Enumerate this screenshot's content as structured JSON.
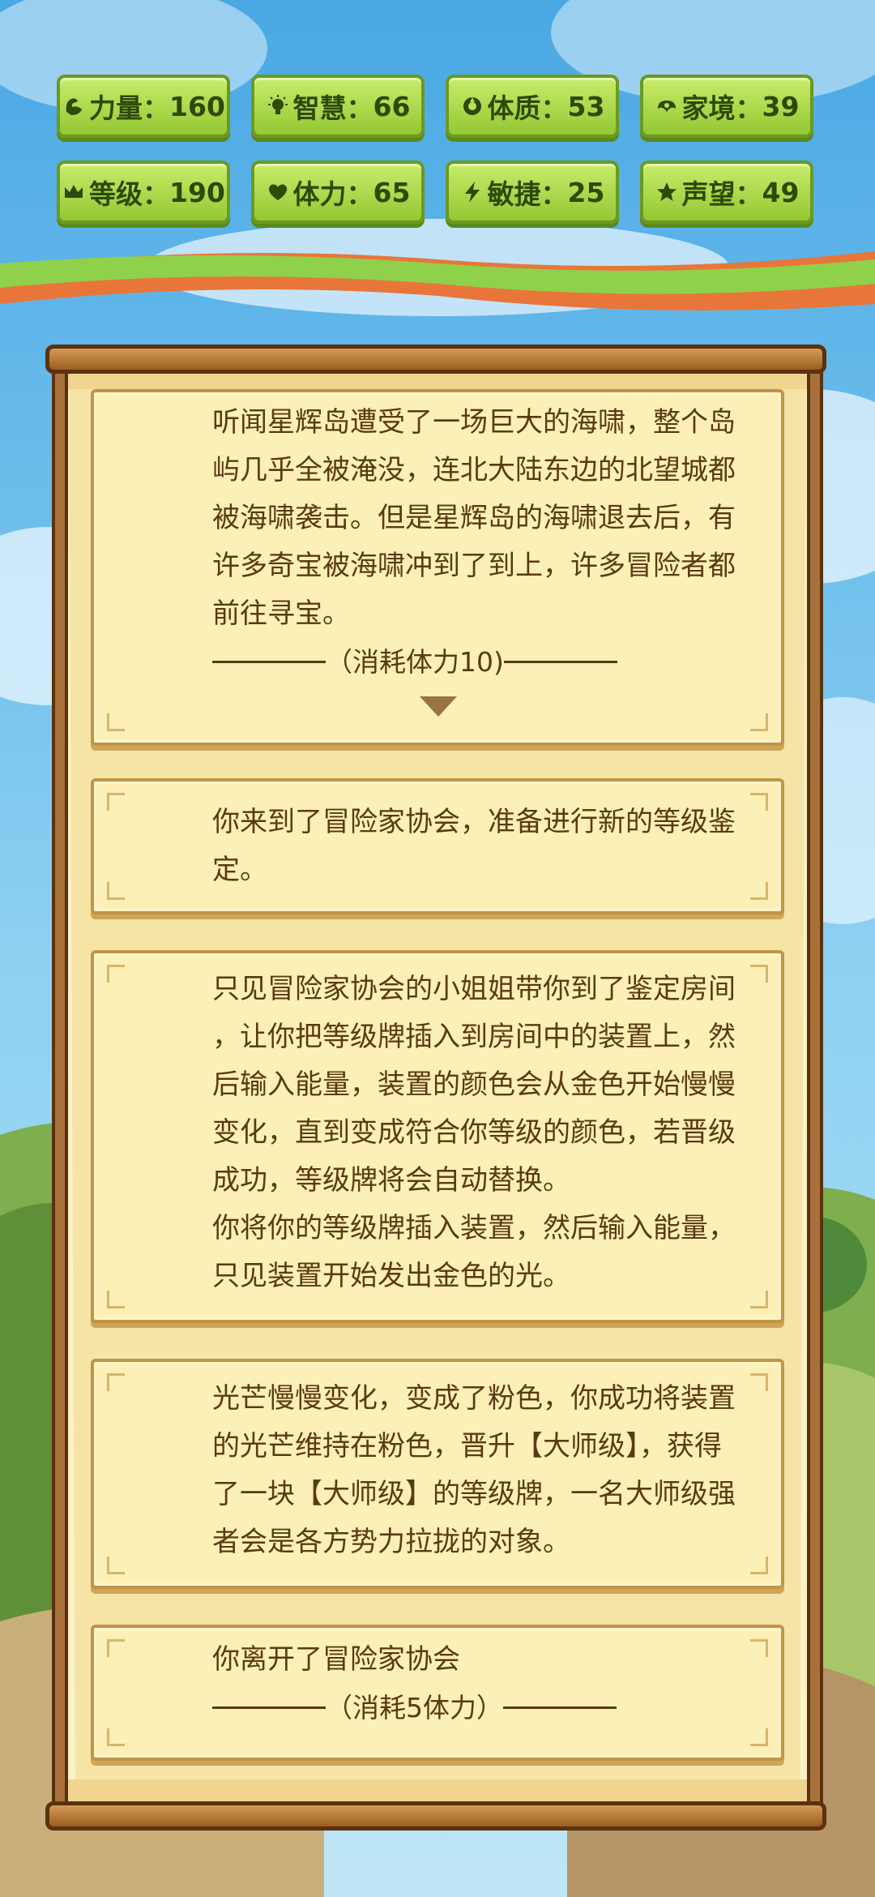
{
  "stats": [
    {
      "label": "力量",
      "value": "160",
      "icon": "muscle-icon"
    },
    {
      "label": "智慧",
      "value": "66",
      "icon": "bulb-icon"
    },
    {
      "label": "体质",
      "value": "53",
      "icon": "constitution-icon"
    },
    {
      "label": "家境",
      "value": "39",
      "icon": "family-icon"
    },
    {
      "label": "等级",
      "value": "190",
      "icon": "crown-icon"
    },
    {
      "label": "体力",
      "value": "65",
      "icon": "heart-icon"
    },
    {
      "label": "敏捷",
      "value": "25",
      "icon": "lightning-icon"
    },
    {
      "label": "声望",
      "value": "49",
      "icon": "star-icon"
    }
  ],
  "story": {
    "card1": {
      "lines": [
        "听闻星辉岛遭受了一场巨大的海啸，整个岛",
        "屿几乎全被淹没，连北大陆东边的北望城都",
        "被海啸袭击。但是星辉岛的海啸退去后，有",
        "许多奇宝被海啸冲到了到上，许多冒险者都",
        "前往寻宝。"
      ],
      "cost": "（消耗体力10)"
    },
    "card2": {
      "lines": [
        "你来到了冒险家协会，准备进行新的等级鉴",
        "定。"
      ]
    },
    "card3": {
      "lines": [
        "只见冒险家协会的小姐姐带你到了鉴定房间",
        "，让你把等级牌插入到房间中的装置上，然",
        "后输入能量，装置的颜色会从金色开始慢慢",
        "变化，直到变成符合你等级的颜色，若晋级",
        "成功，等级牌将会自动替换。",
        "你将你的等级牌插入装置，然后输入能量，",
        "只见装置开始发出金色的光。"
      ]
    },
    "card4": {
      "lines": [
        "光芒慢慢变化，变成了粉色，你成功将装置",
        "的光芒维持在粉色，晋升【大师级】，获得",
        "了一块【大师级】的等级牌，一名大师级强",
        "者会是各方势力拉拢的对象。"
      ]
    },
    "card5": {
      "lines": [
        "你离开了冒险家协会"
      ],
      "cost": "（消耗5体力）"
    }
  },
  "colors": {
    "stat_green": "#a8d84a",
    "card_bg": "#fcf0b6",
    "text": "#5a3a12",
    "frame": "#7a4a1c"
  }
}
